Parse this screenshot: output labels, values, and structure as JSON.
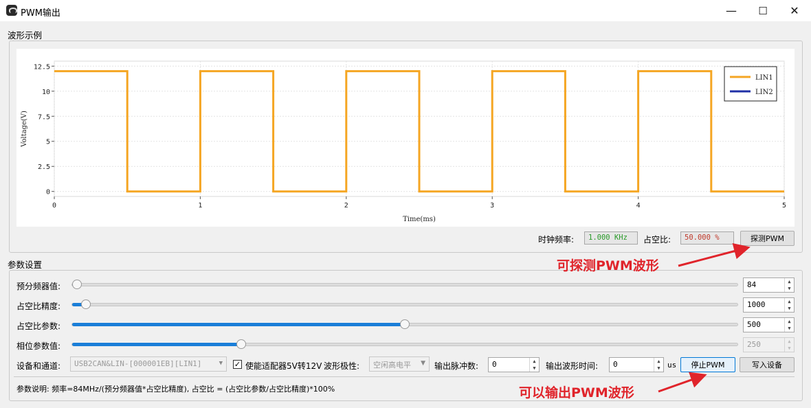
{
  "window": {
    "title": "PWM输出",
    "minimize_glyph": "—",
    "maximize_glyph": "☐",
    "close_glyph": "✕"
  },
  "waveform_group": {
    "title": "波形示例"
  },
  "chart_data": {
    "type": "line",
    "xlabel": "Time(ms)",
    "ylabel": "Voltage(V)",
    "xlim": [
      0,
      5
    ],
    "ylim": [
      -0.5,
      13
    ],
    "x_ticks": [
      0,
      1,
      2,
      3,
      4,
      5
    ],
    "y_ticks": [
      0,
      2.5,
      5,
      7.5,
      10,
      12.5
    ],
    "y_tick_labels": [
      "0",
      "2.5",
      "5",
      "7.5",
      "10",
      "12.5"
    ],
    "grid": true,
    "legend_position": "top-right",
    "series": [
      {
        "name": "LIN1",
        "color": "#f5a623",
        "x": [
          0,
          0.5,
          0.5,
          1,
          1,
          1.5,
          1.5,
          2,
          2,
          2.5,
          2.5,
          3,
          3,
          3.5,
          3.5,
          4,
          4,
          4.5,
          4.5,
          5
        ],
        "y": [
          12,
          12,
          0,
          0,
          12,
          12,
          0,
          0,
          12,
          12,
          0,
          0,
          12,
          12,
          0,
          0,
          12,
          12,
          0,
          0
        ]
      },
      {
        "name": "LIN2",
        "color": "#1f2fa6",
        "x": [],
        "y": []
      }
    ]
  },
  "probe": {
    "clock_label": "时钟频率:",
    "clock_value": "1.000 KHz",
    "clock_color": "#2a9a2a",
    "duty_label": "占空比:",
    "duty_value": "50.000 %",
    "duty_color": "#c0392b",
    "probe_button": "探测PWM"
  },
  "params_group": {
    "title": "参数设置"
  },
  "params": {
    "prescaler": {
      "label": "预分频器值:",
      "value": "84",
      "fraction": 0.0
    },
    "precision": {
      "label": "占空比精度:",
      "value": "1000",
      "fraction": 0.014
    },
    "duty": {
      "label": "占空比参数:",
      "value": "500",
      "fraction": 0.5
    },
    "phase": {
      "label": "相位参数值:",
      "value": "250",
      "fraction": 0.25
    }
  },
  "device": {
    "label": "设备和通道:",
    "selected": "USB2CAN&LIN-[000001EB][LIN1]",
    "enable_checkbox_label": "使能适配器5V转12V",
    "enable_checked": "✓",
    "polarity_label": "波形极性:",
    "polarity_selected": "空闲高电平",
    "pulse_count_label": "输出脉冲数:",
    "pulse_count_value": "0",
    "output_time_label": "输出波形时间:",
    "output_time_value": "0",
    "output_time_unit": "us",
    "stop_button": "停止PWM",
    "write_button": "写入设备"
  },
  "note": "参数说明: 频率=84MHz/(预分频器值*占空比精度), 占空比 = (占空比参数/占空比精度)*100%",
  "annotations": {
    "probe_text": "可探测PWM波形",
    "output_text": "可以输出PWM波形",
    "color": "#e0242b"
  }
}
